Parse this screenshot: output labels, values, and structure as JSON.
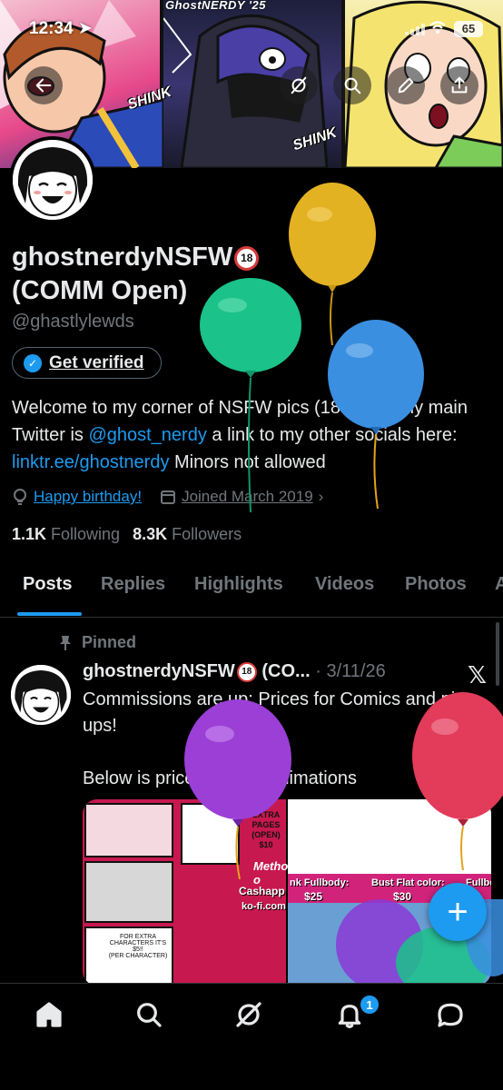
{
  "status_bar": {
    "time": "12:34",
    "battery": "65"
  },
  "banner": {
    "signature": "GhostNERDY '25",
    "sfx_1": "SHINK",
    "sfx_2": "SHINK"
  },
  "profile": {
    "name": "ghostnerdyNSFW",
    "name_badge": "18",
    "name_suffix": "(COMM Open)",
    "handle": "@ghastlylewds",
    "verify_label": "Get verified",
    "bio_1": "Welcome to my corner of NSFW pics (18 & up). my main Twitter is ",
    "bio_link_1": "@ghost_nerdy",
    "bio_2": " a link to my other socials here: ",
    "bio_link_2": "linktr.ee/ghostnerdy",
    "bio_3": " Minors not allowed",
    "birthday": "Happy birthday!",
    "joined": "Joined March 2019",
    "following_count": "1.1K",
    "following_label": "Following",
    "followers_count": "8.3K",
    "followers_label": "Followers"
  },
  "tabs": [
    "Posts",
    "Replies",
    "Highlights",
    "Videos",
    "Photos",
    "A"
  ],
  "post": {
    "pinned_label": "Pinned",
    "author": "ghostnerdyNSFW",
    "author_badge": "18",
    "author_suffix": "(CO...",
    "date": "· 3/11/26",
    "line_1": "Commissions are up; Prices for Comics and pin ups!",
    "line_2": "Below is price for YCH animations",
    "media_text": {
      "extra_pages": "EXTRA PAGES (OPEN) $10",
      "method": "Method o",
      "cashapp": "Cashapp",
      "kofi": "ko-fi.com",
      "ink_fullbody": "nk Fullbody:",
      "ink_price": "$25",
      "bust_flat": "Bust Flat color:",
      "bust_price": "$30",
      "fullbody": "Fullbo",
      "extra_chars": "FOR EXTRA CHARACTERS IT'S $5!!",
      "per_char": "(PER CHARACTER)"
    }
  },
  "fab_label": "+",
  "nav": {
    "notifications_count": "1"
  },
  "colors": {
    "accent": "#1d9bf0",
    "background": "#000000",
    "text": "#e7e9ea",
    "muted": "#71767b"
  }
}
